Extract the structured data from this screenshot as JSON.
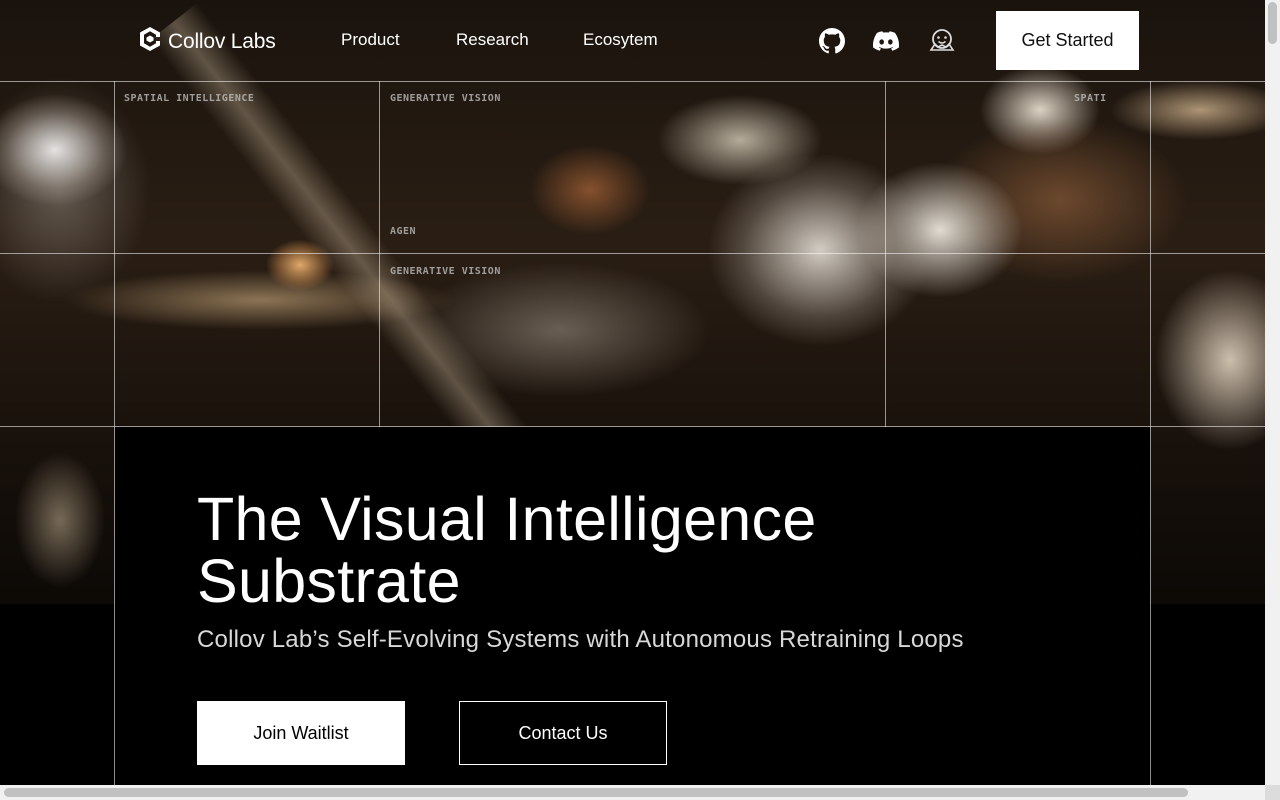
{
  "brand": {
    "name": "Collov Labs",
    "logo_icon": "collov-hexagon-icon"
  },
  "nav": {
    "links": [
      "Product",
      "Research",
      "Ecosytem"
    ],
    "icons": [
      "github-icon",
      "discord-icon",
      "huggingface-icon"
    ],
    "cta": "Get Started"
  },
  "hero": {
    "grid_tags": [
      "SPATIAL INTELLIGENCE",
      "GENERATIVE VISION",
      "SPATI",
      "AGEN",
      "GENERATIVE VISION"
    ],
    "headline": "The Visual Intelligence Substrate",
    "subheadline": "Collov Lab’s Self-Evolving Systems with Autonomous Retraining Loops",
    "primary_button": "Join Waitlist",
    "secondary_button": "Contact Us"
  },
  "colors": {
    "background": "#000000",
    "text": "#ffffff",
    "button_fill": "#ffffff",
    "grid_line": "#ffffff"
  }
}
